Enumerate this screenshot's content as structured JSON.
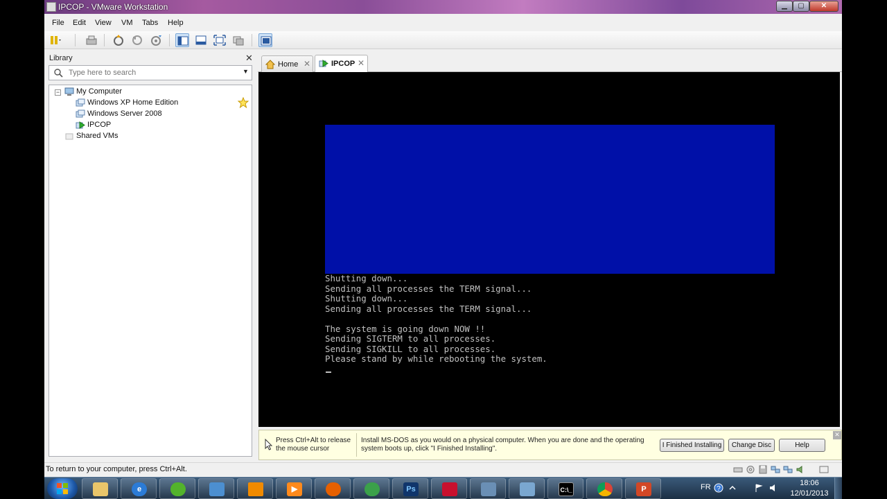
{
  "window": {
    "title": "IPCOP - VMware Workstation"
  },
  "menu": [
    "File",
    "Edit",
    "View",
    "VM",
    "Tabs",
    "Help"
  ],
  "library": {
    "title": "Library",
    "search_placeholder": "Type here to search",
    "tree": {
      "root": "My Computer",
      "vms": [
        "Windows XP Home Edition",
        "Windows Server 2008",
        "IPCOP"
      ],
      "shared": "Shared VMs"
    }
  },
  "tabs": [
    {
      "label": "Home",
      "selected": false
    },
    {
      "label": "IPCOP",
      "selected": true
    }
  ],
  "console": {
    "lines": [
      "Shutting down...",
      "Sending all processes the TERM signal...",
      "Shutting down...",
      "Sending all processes the TERM signal...",
      "",
      "The system is going down NOW !!",
      "Sending SIGTERM to all processes.",
      "Sending SIGKILL to all processes.",
      "Please stand by while rebooting the system."
    ],
    "box_color": "#0010a8"
  },
  "message_bar": {
    "release_hint": "Press Ctrl+Alt to release the mouse cursor",
    "install_text": "Install MS-DOS as you would on a physical computer. When you are done and the operating system boots up, click \"I Finished Installing\".",
    "buttons": {
      "finished": "I Finished Installing",
      "change_disc": "Change Disc",
      "help": "Help"
    }
  },
  "status_bar": {
    "text": "To return to your computer, press Ctrl+Alt."
  },
  "taskbar": {
    "language": "FR",
    "time": "18:06",
    "date": "12/01/2013",
    "apps": [
      "explorer",
      "internet-explorer",
      "media",
      "network",
      "vlc",
      "media-player",
      "firefox",
      "globe",
      "photoshop",
      "acrobat",
      "vmware",
      "remote-desktop",
      "command-prompt",
      "chrome",
      "powerpoint"
    ]
  }
}
